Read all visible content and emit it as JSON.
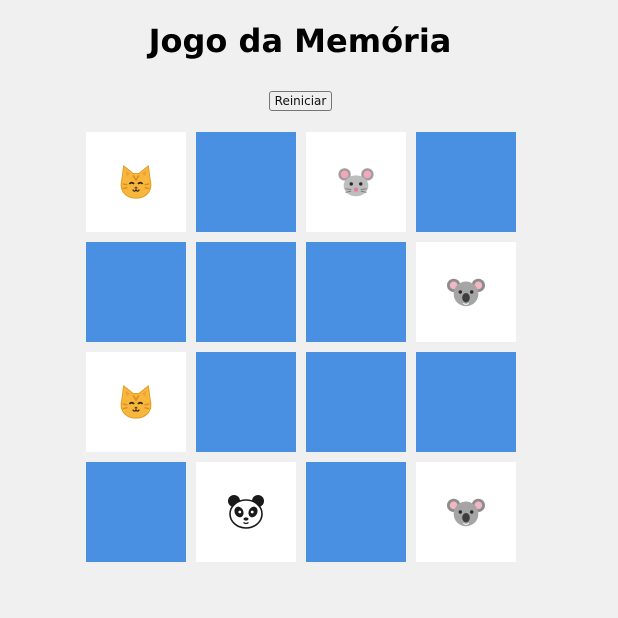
{
  "title": "Jogo da Memória",
  "restart_label": "Reiniciar",
  "colors": {
    "card_back": "#4a90e2",
    "card_front": "#ffffff",
    "background": "#f0f0f0"
  },
  "cards": [
    {
      "state": "revealed",
      "animal": "cat"
    },
    {
      "state": "hidden"
    },
    {
      "state": "revealed",
      "animal": "mouse"
    },
    {
      "state": "hidden"
    },
    {
      "state": "hidden"
    },
    {
      "state": "hidden"
    },
    {
      "state": "hidden"
    },
    {
      "state": "revealed",
      "animal": "koala"
    },
    {
      "state": "revealed",
      "animal": "cat"
    },
    {
      "state": "hidden"
    },
    {
      "state": "hidden"
    },
    {
      "state": "hidden"
    },
    {
      "state": "hidden"
    },
    {
      "state": "revealed",
      "animal": "panda"
    },
    {
      "state": "hidden"
    },
    {
      "state": "revealed",
      "animal": "koala"
    }
  ]
}
